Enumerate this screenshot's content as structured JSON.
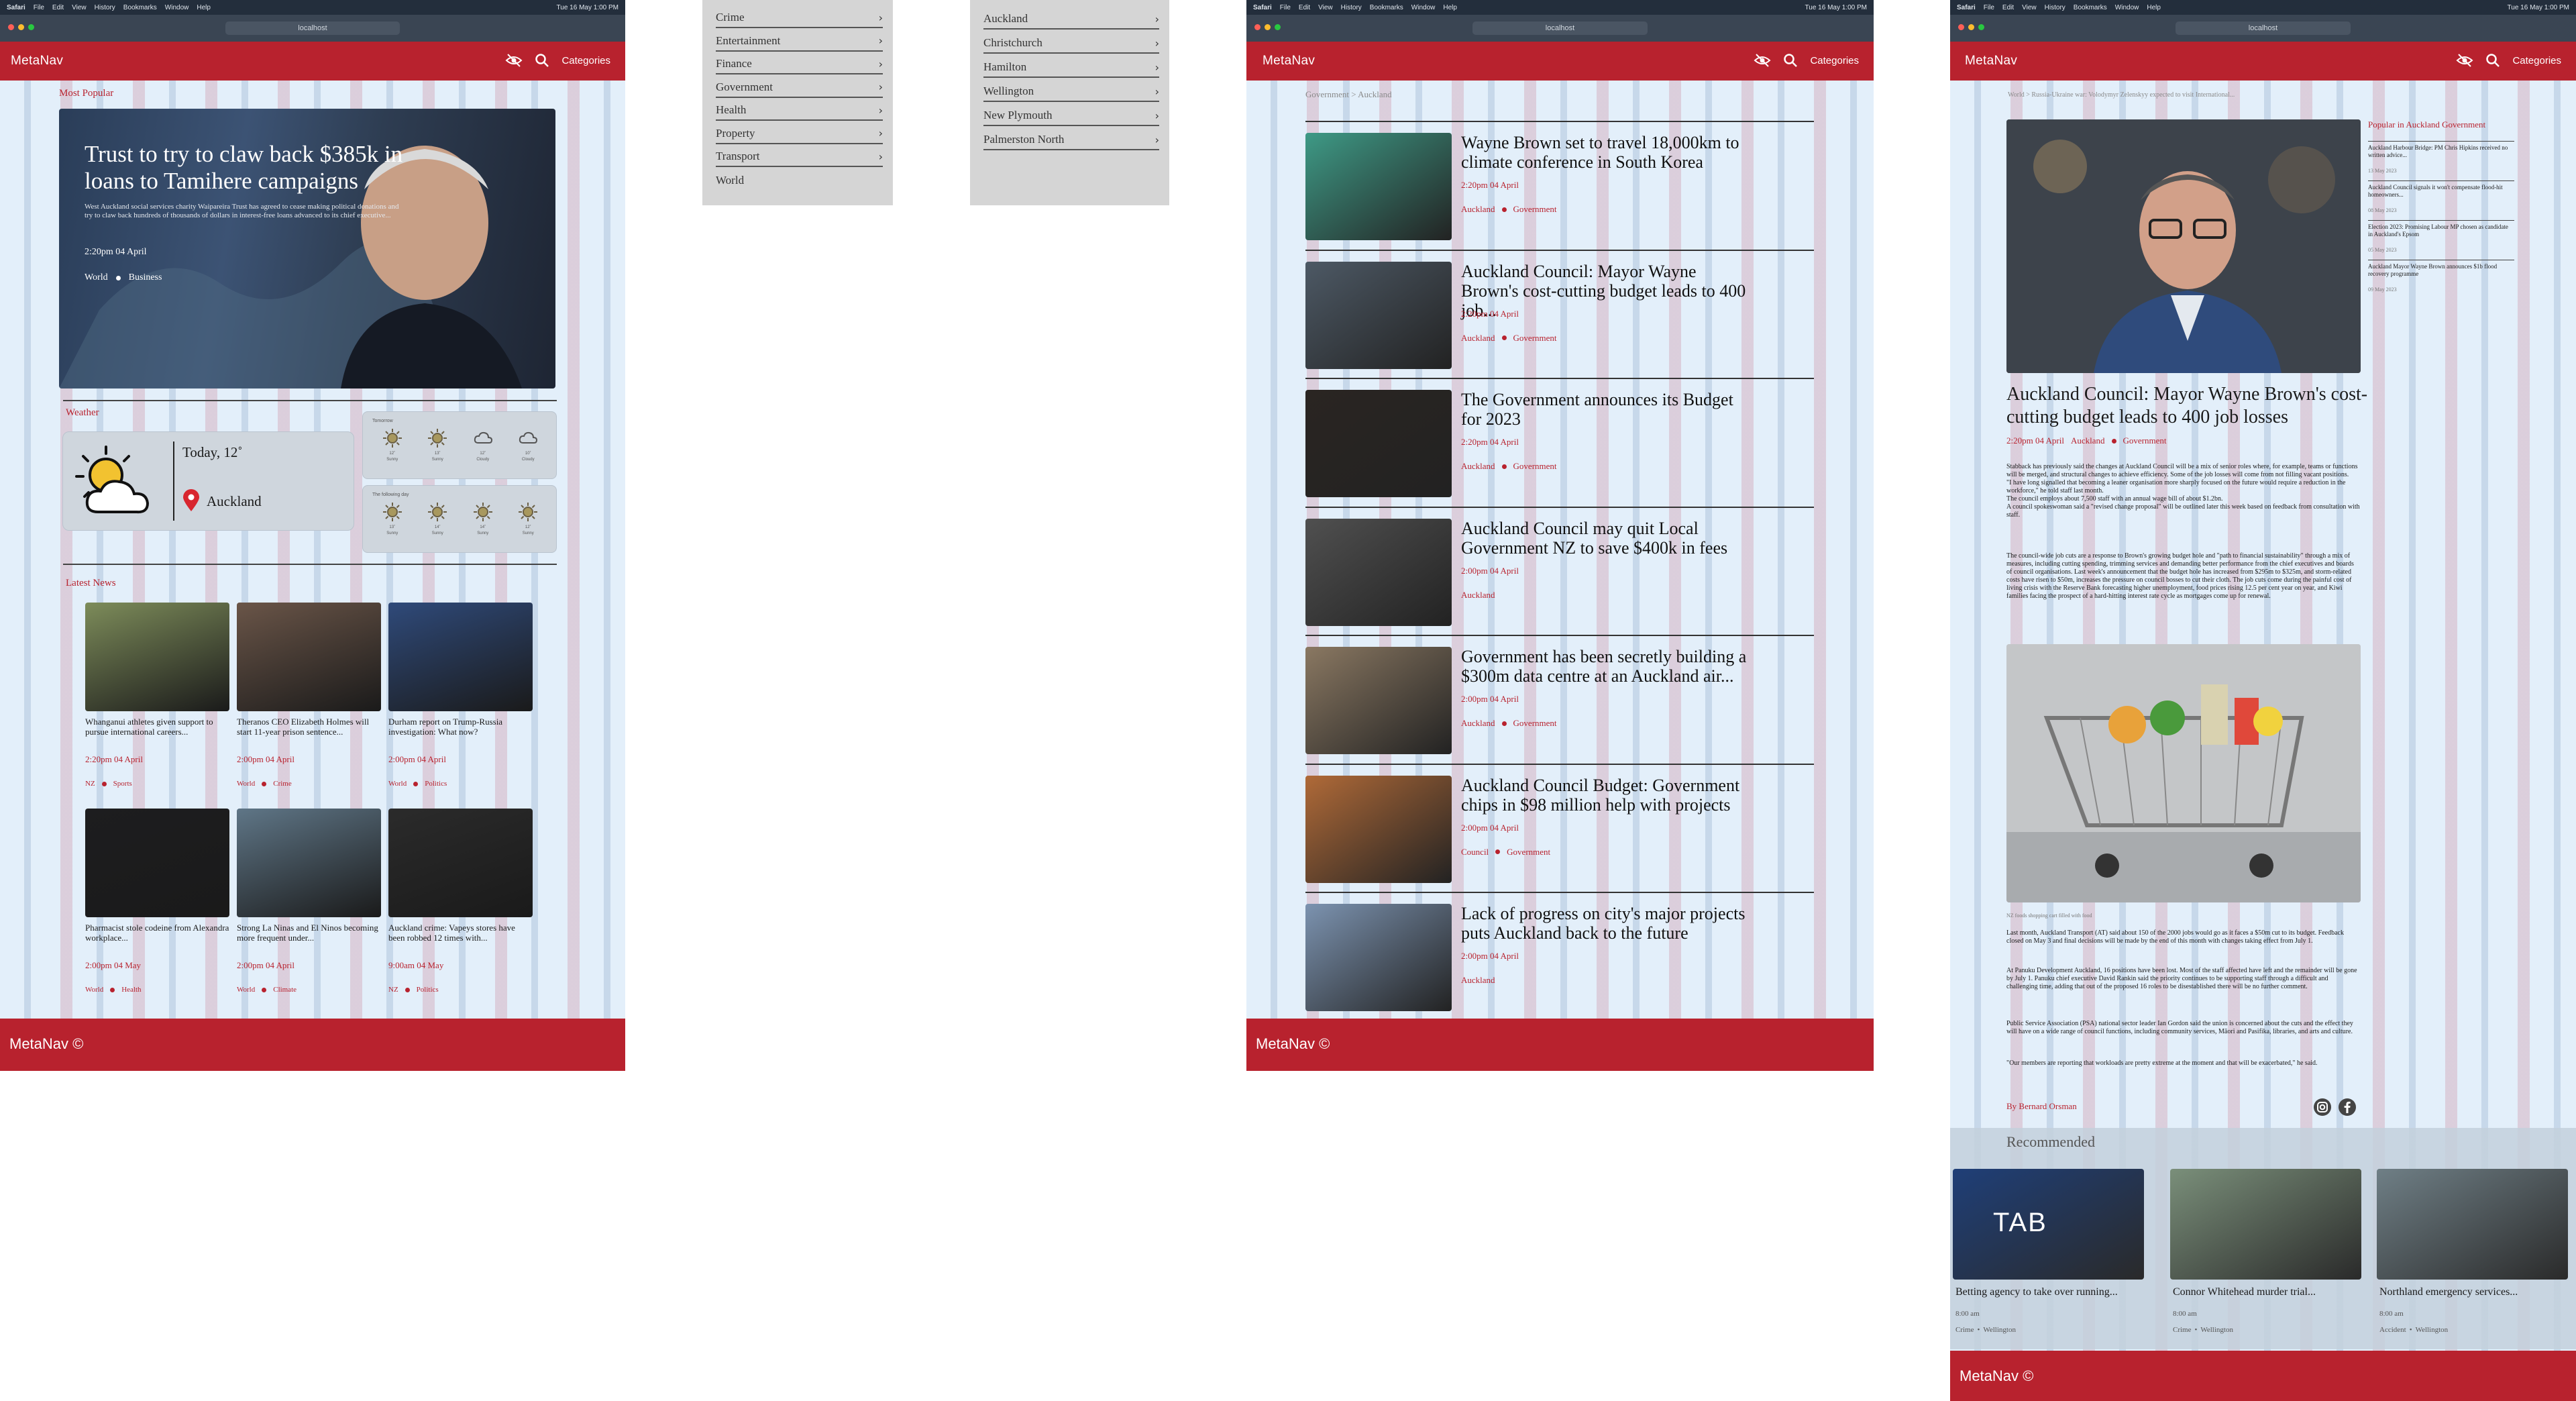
{
  "mac": {
    "apple": "",
    "app": "Safari",
    "menus": [
      "File",
      "Edit",
      "View",
      "History",
      "Bookmarks",
      "Window",
      "Help"
    ],
    "clock": "Tue 16 May 1:00 PM"
  },
  "browser": {
    "url": "localhost"
  },
  "nav": {
    "brand": "MetaNav",
    "categories_label": "Categories",
    "search_icon": "search-icon",
    "accessibility_icon": "eye-off-icon"
  },
  "footer": {
    "text": "MetaNav  ©"
  },
  "home": {
    "most_popular_label": "Most Popular",
    "hero": {
      "title": "Trust to try to claw back $385k in loans to Tamihere campaigns",
      "summary": "West Auckland social services charity Waipareira Trust has agreed to cease making political donations and try to claw back hundreds of thousands of dollars in interest-free loans advanced to its chief executive...",
      "time": "2:20pm 04 April",
      "tags": [
        "World",
        "Business"
      ]
    },
    "weather": {
      "label": "Weather",
      "today": "Today, 12˚",
      "location": "Auckland",
      "tomorrow_label": "Tomorrow",
      "following_label": "The following day",
      "tomorrow": [
        {
          "temp": "12˚",
          "cond": "Sunny"
        },
        {
          "temp": "13˚",
          "cond": "Sunny"
        },
        {
          "temp": "12˚",
          "cond": "Cloudy"
        },
        {
          "temp": "10˚",
          "cond": "Cloudy"
        }
      ],
      "following": [
        {
          "temp": "13˚",
          "cond": "Sunny"
        },
        {
          "temp": "14˚",
          "cond": "Sunny"
        },
        {
          "temp": "14˚",
          "cond": "Sunny"
        },
        {
          "temp": "12˚",
          "cond": "Sunny"
        }
      ]
    },
    "latest_label": "Latest News",
    "latest": [
      {
        "title": "Whanganui athletes given support to pursue international careers...",
        "time": "2:20pm 04 April",
        "tags": [
          "NZ",
          "Sports"
        ],
        "bg": "#7d8c5a"
      },
      {
        "title": "Theranos CEO Elizabeth Holmes will start 11-year prison sentence...",
        "time": "2:00pm 04 April",
        "tags": [
          "World",
          "Crime"
        ],
        "bg": "#6a5548"
      },
      {
        "title": "Durham report on Trump-Russia investigation: What now?",
        "time": "2:00pm 04 April",
        "tags": [
          "World",
          "Politics"
        ],
        "bg": "#2f4a7a"
      },
      {
        "title": "Pharmacist stole codeine from Alexandra workplace...",
        "time": "2:00pm 04 May",
        "tags": [
          "World",
          "Health"
        ],
        "bg": "#1d1d1f"
      },
      {
        "title": "Strong La Ninas and El Ninos becoming more frequent under...",
        "time": "2:00pm 04 April",
        "tags": [
          "World",
          "Climate"
        ],
        "bg": "#5f7687"
      },
      {
        "title": "Auckland crime: Vapeys stores have been robbed 12 times with...",
        "time": "9:00am 04 May",
        "tags": [
          "NZ",
          "Politics"
        ],
        "bg": "#2b2b2b"
      }
    ]
  },
  "categories_menu": [
    "Crime",
    "Entertainment",
    "Finance",
    "Government",
    "Health",
    "Property",
    "Transport",
    "World"
  ],
  "regions_menu": [
    "Auckland",
    "Christchurch",
    "Hamilton",
    "Wellington",
    "New Plymouth",
    "Palmerston North"
  ],
  "listing": {
    "breadcrumb": "Government > Auckland",
    "items": [
      {
        "title": "Wayne Brown set to travel 18,000km to climate conference in South Korea",
        "time": "2:20pm 04 April",
        "tags": [
          "Auckland",
          "Government"
        ],
        "bg": "#3e9a86"
      },
      {
        "title": "Auckland Council: Mayor Wayne Brown's cost-cutting budget leads to 400 job...",
        "time": "2:20pm 04 April",
        "tags": [
          "Auckland",
          "Government"
        ],
        "bg": "#4d5965"
      },
      {
        "title": "The Government announces its Budget for 2023",
        "time": "2:20pm 04 April",
        "tags": [
          "Auckland",
          "Government"
        ],
        "bg": "#2a2522"
      },
      {
        "title": "Auckland Council may quit Local Government NZ to save $400k in fees",
        "time": "2:00pm 04 April",
        "tags": [
          "Auckland"
        ],
        "bg": "#505050"
      },
      {
        "title": "Government has been secretly building a $300m data centre at an Auckland air...",
        "time": "2:00pm 04 April",
        "tags": [
          "Auckland",
          "Government"
        ],
        "bg": "#8a7862"
      },
      {
        "title": "Auckland Council Budget: Government chips in $98 million help with projects",
        "time": "2:00pm 04 April",
        "tags": [
          "Council",
          "Government"
        ],
        "bg": "#b06a38"
      },
      {
        "title": "Lack of progress on city's major projects puts Auckland back to the future",
        "time": "2:00pm 04 April",
        "tags": [
          "Auckland"
        ],
        "bg": "#7c93b0"
      }
    ]
  },
  "article": {
    "breadcrumb": "World > Russia-Ukraine war: Volodymyr Zelenskyy expected to visit International...",
    "title": "Auckland Council: Mayor Wayne Brown's cost-cutting budget leads to 400 job losses",
    "time": "2:20pm 04 April",
    "tags": [
      "Auckland",
      "Government"
    ],
    "body1": "Stabback has previously said the changes at Auckland Council will be a mix of senior roles where, for example, teams or functions will be merged, and structural changes to achieve efficiency. Some of the job losses will come from not filling vacant positions.\n\"I have long signalled that becoming a leaner organisation more sharply focused on the future would require a reduction in the workforce,\" he told staff last month.\nThe council employs about 7,500 staff with an annual wage bill of about $1.2bn.\nA council spokeswoman said a \"revised change proposal\" will be outlined later this week based on feedback from consultation with staff.",
    "body2": "The council-wide job cuts are a response to Brown's growing budget hole and \"path to financial sustainability\" through a mix of measures, including cutting spending, trimming services and demanding better performance from the chief executives and boards of council organisations. Last week's announcement that the budget hole has increased from $295m to $325m, and storm-related costs have risen to $50m, increases the pressure on council bosses to cut their cloth. The job cuts come during the painful cost of living crisis with the Reserve Bank forecasting higher unemployment, food prices rising 12.5 per cent year on year, and Kiwi families facing the prospect of a hard-hitting interest rate cycle as mortgages come up for renewal.",
    "caption": "NZ foods shopping cart filled with food",
    "body3": "Last month, Auckland Transport (AT) said about 150 of the 2000 jobs would go as it faces a $50m cut to its budget. Feedback closed on May 3 and final decisions will be made by the end of this month with changes taking effect from July 1.",
    "body4": "At Panuku Development Auckland, 16 positions have been lost. Most of the staff affected have left and the remainder will be gone by July 1. Panuku chief executive David Rankin said the priority continues to be supporting staff through a difficult and challenging time, adding that out of the proposed 16 roles to be disestablished there will be no further comment.",
    "body5": "Public Service Association (PSA) national sector leader Ian Gordon said the union is concerned about the cuts and the effect they will have on a wide range of council functions, including community services, Māori and Pasifika, libraries, and arts and culture.",
    "body6": "\"Our members are reporting that workloads are pretty extreme at the moment and that will be exacerbated,\" he said.",
    "author": "By Bernard Orsman",
    "popular_label": "Popular in",
    "popular_topic": "Auckland Government",
    "popular": [
      {
        "title": "Auckland Harbour Bridge: PM Chris Hipkins received no written advice...",
        "date": "13 May 2023"
      },
      {
        "title": "Auckland Council signals it won't compensate flood-hit homeowners...",
        "date": "08 May 2023"
      },
      {
        "title": "Election 2023: Promising Labour MP chosen as candidate in Auckland's Epsom",
        "date": "05 May 2023"
      },
      {
        "title": "Auckland Mayor Wayne Brown announces $1b flood recovery programme",
        "date": "09 May 2023"
      }
    ],
    "recommended_label": "Recommended",
    "recommended": [
      {
        "title": "Betting agency to take over running...",
        "time": "8:00 am",
        "tags": [
          "Crime",
          "Wellington"
        ],
        "bg": "#1f3f78",
        "sign": "TAB"
      },
      {
        "title": "Connor Whitehead murder trial...",
        "time": "8:00 am",
        "tags": [
          "Crime",
          "Wellington"
        ],
        "bg": "#7a8f7a",
        "sign": ""
      },
      {
        "title": "Northland emergency services...",
        "time": "8:00 am",
        "tags": [
          "Accident",
          "Wellington"
        ],
        "bg": "#6f7f86",
        "sign": ""
      }
    ]
  }
}
